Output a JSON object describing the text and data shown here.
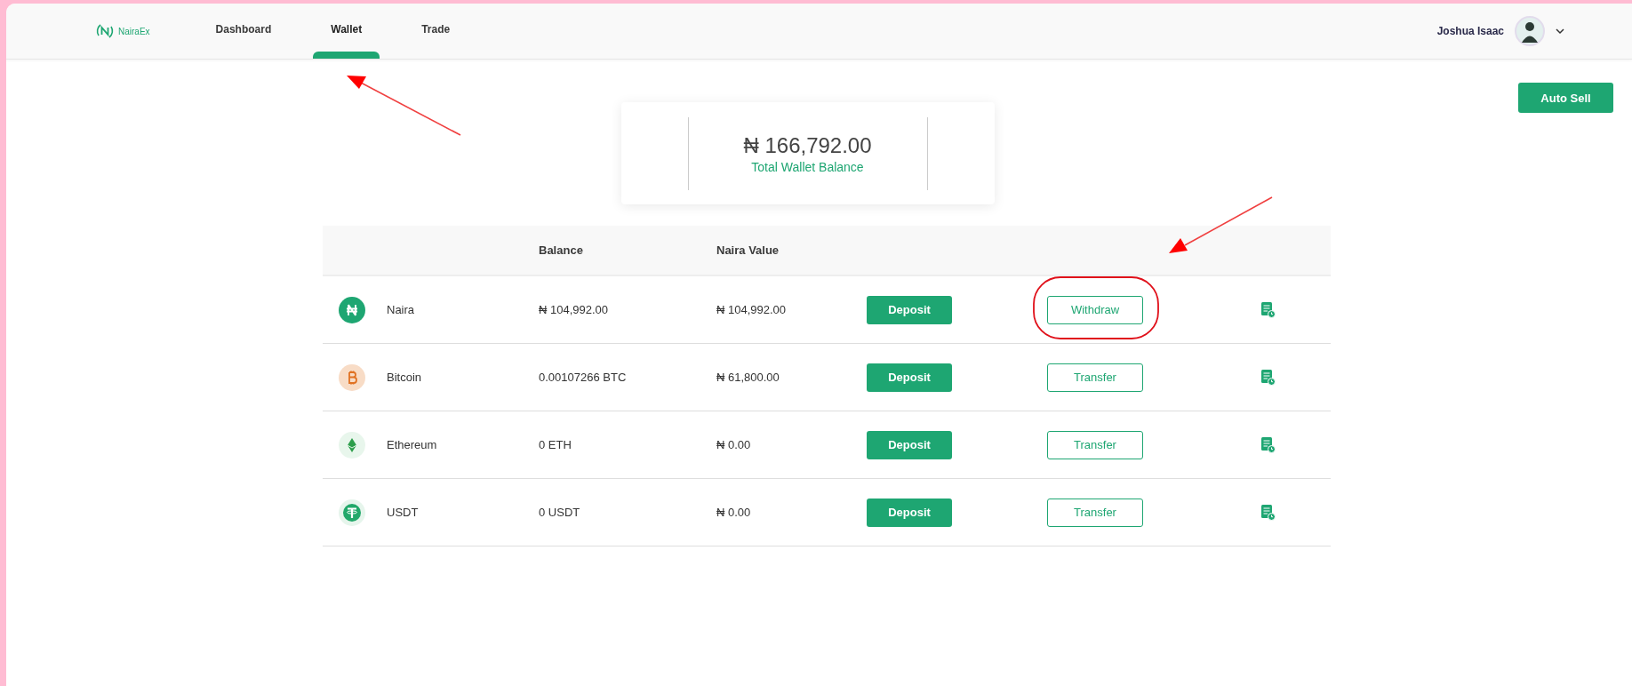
{
  "brand": {
    "name": "NairaEx"
  },
  "nav": [
    {
      "label": "Dashboard",
      "selected": false
    },
    {
      "label": "Wallet",
      "selected": true
    },
    {
      "label": "Trade",
      "selected": false
    }
  ],
  "user": {
    "name": "Joshua Isaac"
  },
  "auto_sell_button": "Auto Sell",
  "balance_card": {
    "amount": "₦ 166,792.00",
    "label": "Total Wallet Balance"
  },
  "table": {
    "columns": [
      "Balance",
      "Naira Value"
    ],
    "rows": [
      {
        "kind": "naira",
        "asset": "Naira",
        "balance": "₦ 104,992.00",
        "naira_value": "₦ 104,992.00",
        "primary_action": "Deposit",
        "secondary_action": "Withdraw"
      },
      {
        "kind": "bitcoin",
        "asset": "Bitcoin",
        "balance": "0.00107266 BTC",
        "naira_value": "₦ 61,800.00",
        "primary_action": "Deposit",
        "secondary_action": "Transfer"
      },
      {
        "kind": "ethereum",
        "asset": "Ethereum",
        "balance": "0 ETH",
        "naira_value": "₦ 0.00",
        "primary_action": "Deposit",
        "secondary_action": "Transfer"
      },
      {
        "kind": "usdt",
        "asset": "USDT",
        "balance": "0 USDT",
        "naira_value": "₦ 0.00",
        "primary_action": "Deposit",
        "secondary_action": "Transfer"
      }
    ]
  }
}
